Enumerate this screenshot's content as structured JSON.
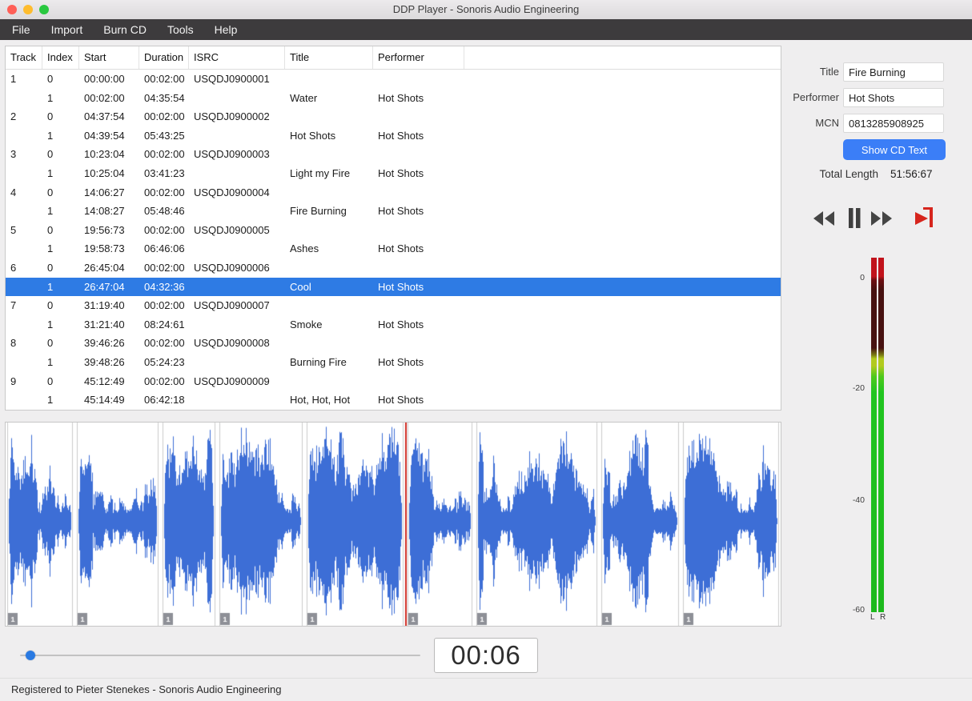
{
  "window": {
    "title": "DDP Player - Sonoris Audio Engineering"
  },
  "menu": {
    "items": [
      {
        "id": "file",
        "label": "File"
      },
      {
        "id": "import",
        "label": "Import"
      },
      {
        "id": "burn-cd",
        "label": "Burn CD"
      },
      {
        "id": "tools",
        "label": "Tools"
      },
      {
        "id": "help",
        "label": "Help"
      }
    ]
  },
  "track_table": {
    "columns": [
      {
        "key": "track",
        "label": "Track"
      },
      {
        "key": "index",
        "label": "Index"
      },
      {
        "key": "start",
        "label": "Start"
      },
      {
        "key": "duration",
        "label": "Duration"
      },
      {
        "key": "isrc",
        "label": "ISRC"
      },
      {
        "key": "title",
        "label": "Title"
      },
      {
        "key": "performer",
        "label": "Performer"
      },
      {
        "key": "filler",
        "label": ""
      }
    ],
    "rows": [
      {
        "track": "1",
        "index": "0",
        "start": "00:00:00",
        "duration": "00:02:00",
        "isrc": "USQDJ0900001",
        "title": "",
        "performer": "",
        "selected": false
      },
      {
        "track": "",
        "index": "1",
        "start": "00:02:00",
        "duration": "04:35:54",
        "isrc": "",
        "title": "Water",
        "performer": "Hot Shots",
        "selected": false
      },
      {
        "track": "2",
        "index": "0",
        "start": "04:37:54",
        "duration": "00:02:00",
        "isrc": "USQDJ0900002",
        "title": "",
        "performer": "",
        "selected": false
      },
      {
        "track": "",
        "index": "1",
        "start": "04:39:54",
        "duration": "05:43:25",
        "isrc": "",
        "title": "Hot Shots",
        "performer": "Hot Shots",
        "selected": false
      },
      {
        "track": "3",
        "index": "0",
        "start": "10:23:04",
        "duration": "00:02:00",
        "isrc": "USQDJ0900003",
        "title": "",
        "performer": "",
        "selected": false
      },
      {
        "track": "",
        "index": "1",
        "start": "10:25:04",
        "duration": "03:41:23",
        "isrc": "",
        "title": "Light my Fire",
        "performer": "Hot Shots",
        "selected": false
      },
      {
        "track": "4",
        "index": "0",
        "start": "14:06:27",
        "duration": "00:02:00",
        "isrc": "USQDJ0900004",
        "title": "",
        "performer": "",
        "selected": false
      },
      {
        "track": "",
        "index": "1",
        "start": "14:08:27",
        "duration": "05:48:46",
        "isrc": "",
        "title": "Fire Burning",
        "performer": "Hot Shots",
        "selected": false
      },
      {
        "track": "5",
        "index": "0",
        "start": "19:56:73",
        "duration": "00:02:00",
        "isrc": "USQDJ0900005",
        "title": "",
        "performer": "",
        "selected": false
      },
      {
        "track": "",
        "index": "1",
        "start": "19:58:73",
        "duration": "06:46:06",
        "isrc": "",
        "title": "Ashes",
        "performer": "Hot Shots",
        "selected": false
      },
      {
        "track": "6",
        "index": "0",
        "start": "26:45:04",
        "duration": "00:02:00",
        "isrc": "USQDJ0900006",
        "title": "",
        "performer": "",
        "selected": false
      },
      {
        "track": "",
        "index": "1",
        "start": "26:47:04",
        "duration": "04:32:36",
        "isrc": "",
        "title": "Cool",
        "performer": "Hot Shots",
        "selected": true
      },
      {
        "track": "7",
        "index": "0",
        "start": "31:19:40",
        "duration": "00:02:00",
        "isrc": "USQDJ0900007",
        "title": "",
        "performer": "",
        "selected": false
      },
      {
        "track": "",
        "index": "1",
        "start": "31:21:40",
        "duration": "08:24:61",
        "isrc": "",
        "title": "Smoke",
        "performer": "Hot Shots",
        "selected": false
      },
      {
        "track": "8",
        "index": "0",
        "start": "39:46:26",
        "duration": "00:02:00",
        "isrc": "USQDJ0900008",
        "title": "",
        "performer": "",
        "selected": false
      },
      {
        "track": "",
        "index": "1",
        "start": "39:48:26",
        "duration": "05:24:23",
        "isrc": "",
        "title": "Burning Fire",
        "performer": "Hot Shots",
        "selected": false
      },
      {
        "track": "9",
        "index": "0",
        "start": "45:12:49",
        "duration": "00:02:00",
        "isrc": "USQDJ0900009",
        "title": "",
        "performer": "",
        "selected": false
      },
      {
        "track": "",
        "index": "1",
        "start": "45:14:49",
        "duration": "06:42:18",
        "isrc": "",
        "title": "Hot, Hot, Hot",
        "performer": "Hot Shots",
        "selected": false
      }
    ]
  },
  "inspector": {
    "title_label": "Title",
    "title_value": "Fire Burning",
    "performer_label": "Performer",
    "performer_value": "Hot Shots",
    "mcn_label": "MCN",
    "mcn_value": "0813285908925",
    "show_cd_text_label": "Show CD Text",
    "total_length_label": "Total Length",
    "total_length_value": "51:56:67"
  },
  "meter": {
    "scale_labels": [
      "0",
      "-20",
      "-40",
      "-60"
    ],
    "channel_labels": [
      "L",
      "R"
    ]
  },
  "waveform": {
    "segments": [
      {
        "marker": "1",
        "length_s": 276
      },
      {
        "marker": "1",
        "length_s": 343
      },
      {
        "marker": "1",
        "length_s": 221
      },
      {
        "marker": "1",
        "length_s": 349
      },
      {
        "marker": "1",
        "length_s": 406
      },
      {
        "marker": "1",
        "length_s": 272
      },
      {
        "marker": "1",
        "length_s": 505
      },
      {
        "marker": "1",
        "length_s": 324
      },
      {
        "marker": "1",
        "length_s": 402
      }
    ],
    "playhead_segment_index": 5
  },
  "playback": {
    "time": "00:06",
    "slider_value": 0.015
  },
  "status": {
    "text": "Registered to Pieter Stenekes - Sonoris Audio Engineering"
  },
  "colors": {
    "selection": "#2e7be4",
    "accent_button": "#3b7ef7",
    "waveform": "#3d6ed6",
    "playhead": "#d02b22"
  }
}
